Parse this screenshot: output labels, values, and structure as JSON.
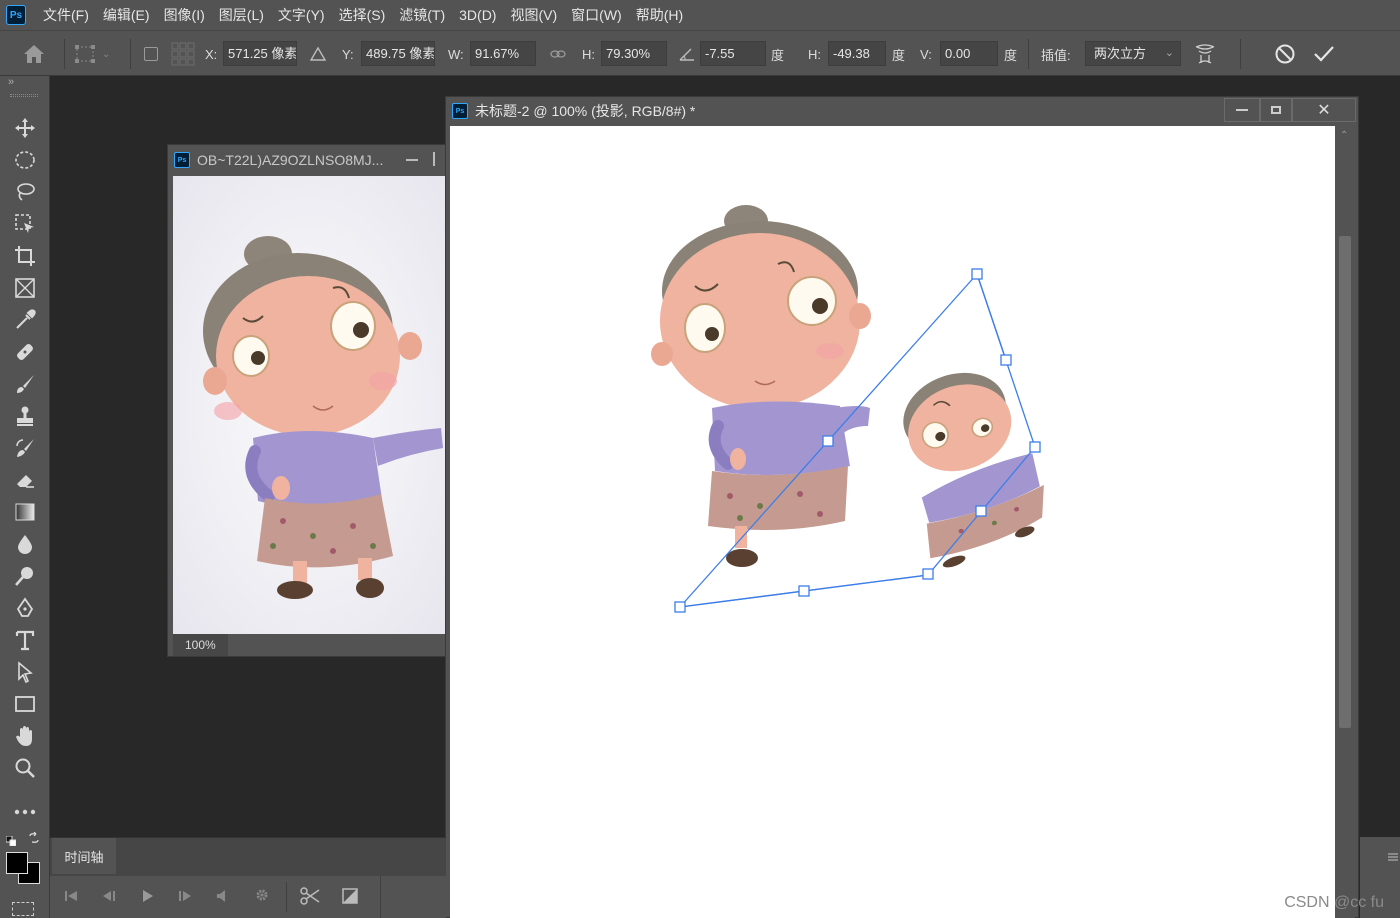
{
  "app": {
    "logo": "Ps"
  },
  "menus": [
    "文件(F)",
    "编辑(E)",
    "图像(I)",
    "图层(L)",
    "文字(Y)",
    "选择(S)",
    "滤镜(T)",
    "3D(D)",
    "视图(V)",
    "窗口(W)",
    "帮助(H)"
  ],
  "options": {
    "x_label": "X:",
    "x_value": "571.25 像素",
    "y_label": "Y:",
    "y_value": "489.75 像素",
    "w_label": "W:",
    "w_value": "91.67%",
    "h_label": "H:",
    "h_value": "79.30%",
    "angle_value": "-7.55",
    "angle_unit": "度",
    "hskew_label": "H:",
    "hskew_value": "-49.38",
    "hskew_unit": "度",
    "vskew_label": "V:",
    "vskew_value": "0.00",
    "vskew_unit": "度",
    "interp_label": "插值:",
    "interp_value": "两次立方"
  },
  "doc_small": {
    "title": "OB~T22L)AZ9OZLNSO8MJ...",
    "zoom": "100%"
  },
  "doc_main": {
    "title": "未标题-2 @ 100% (投影, RGB/8#) *"
  },
  "timeline": {
    "tab": "时间轴"
  },
  "watermark": "CSDN @cc fu",
  "colors": {
    "accent": "#31a8ff",
    "transform_box": "#3d7ee8",
    "menubar": "#535353",
    "workspace": "#282828"
  }
}
